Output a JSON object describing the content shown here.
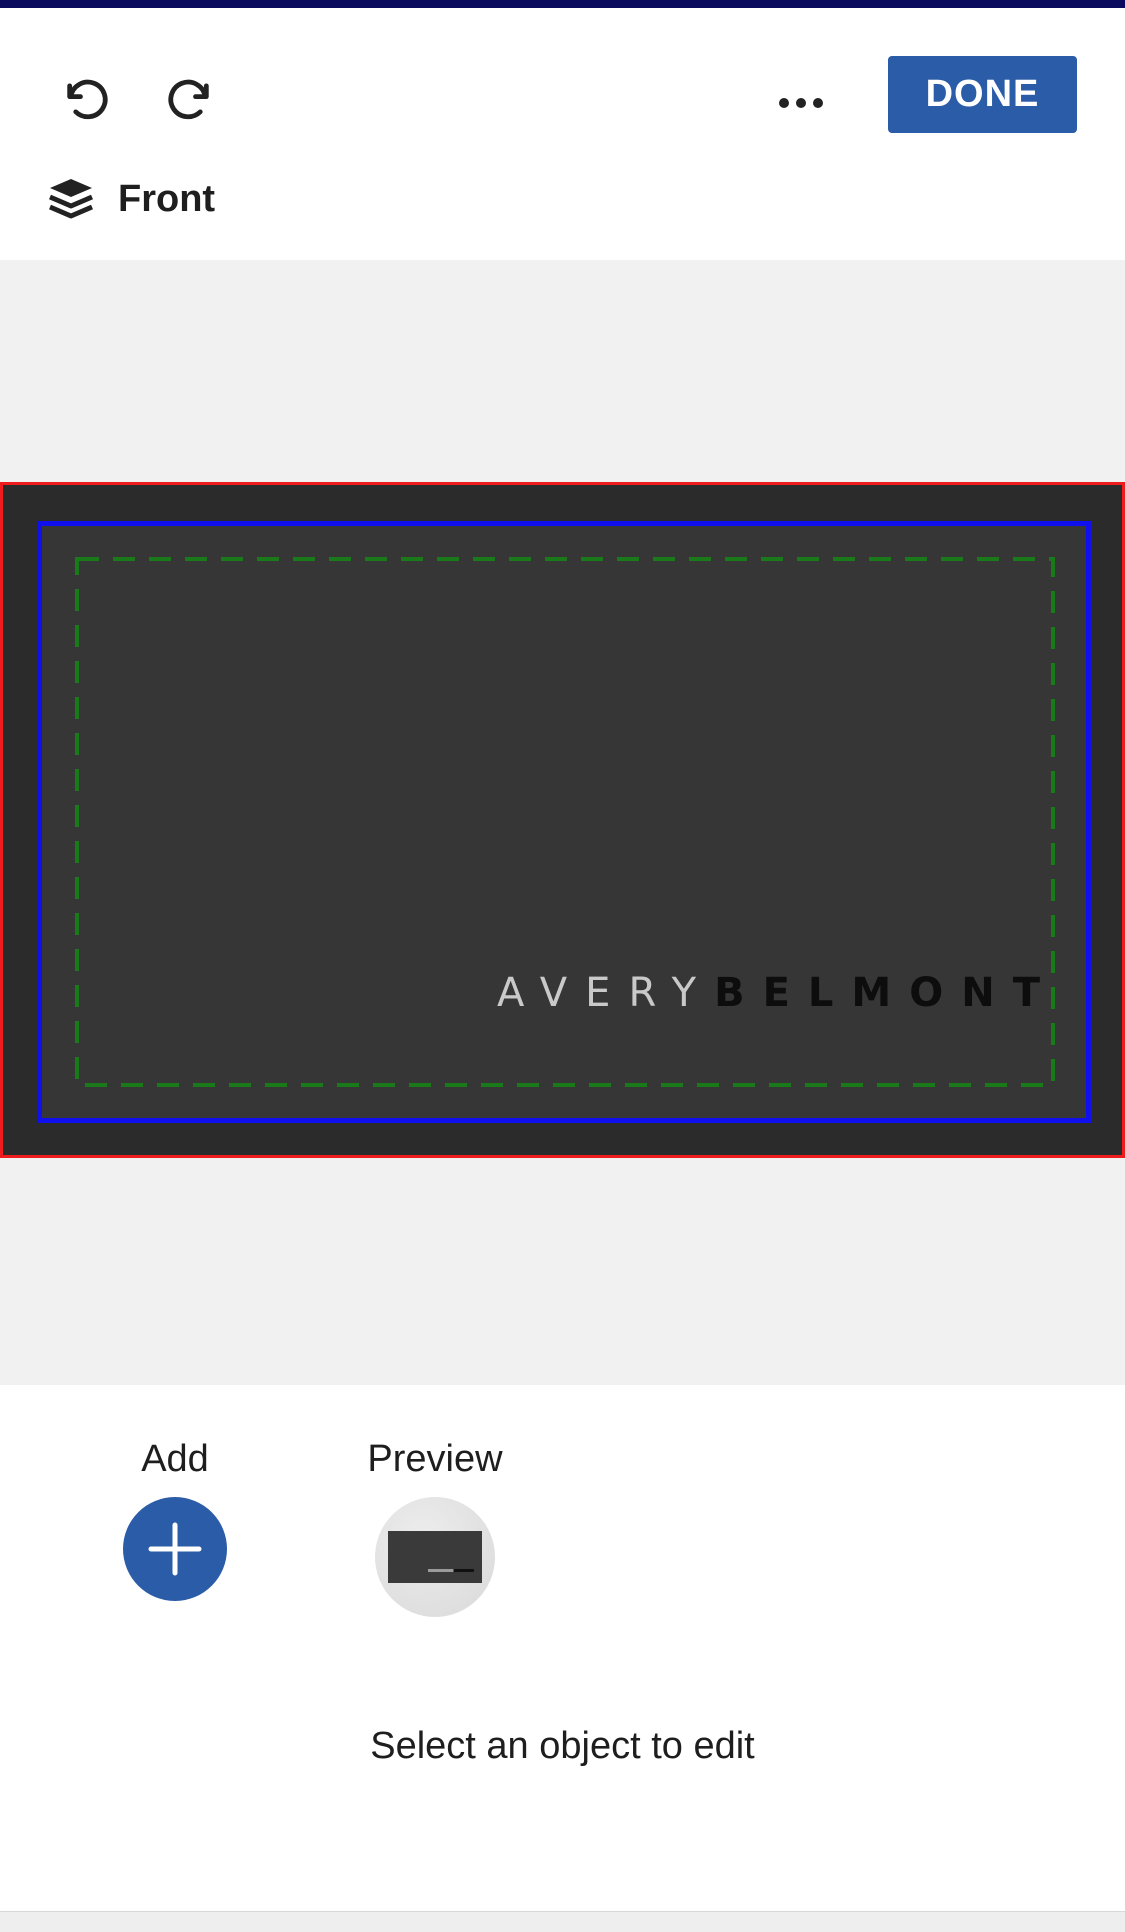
{
  "toolbar": {
    "undo_icon": "undo-icon",
    "redo_icon": "redo-icon",
    "more_icon": "more-horizontal-icon",
    "done_label": "DONE"
  },
  "layer": {
    "icon": "layers-icon",
    "label": "Front"
  },
  "card": {
    "logo_light": "AVERY",
    "logo_dark": "BELMONT",
    "background_color": "#2b2b2b",
    "bleed_color": "#ee1c1c",
    "trim_color": "#1010ee",
    "safe_color": "#1a7a1a"
  },
  "tools": {
    "add_label": "Add",
    "add_icon": "plus-icon",
    "preview_label": "Preview"
  },
  "hint": "Select an object to edit",
  "colors": {
    "accent": "#2b5ca8"
  }
}
